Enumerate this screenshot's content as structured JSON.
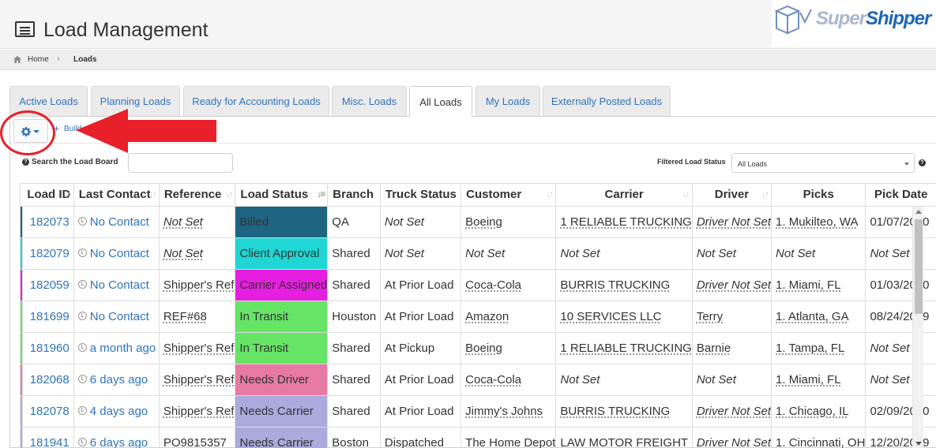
{
  "header": {
    "title": "Load Management",
    "icon": "list-box-icon"
  },
  "logo": {
    "super": "Super",
    "shipper": "Shipper"
  },
  "breadcrumb": {
    "home": "Home",
    "current": "Loads"
  },
  "tabs": [
    {
      "label": "Active Loads",
      "active": false
    },
    {
      "label": "Planning Loads",
      "active": false
    },
    {
      "label": "Ready for Accounting Loads",
      "active": false
    },
    {
      "label": "Misc. Loads",
      "active": false
    },
    {
      "label": "All Loads",
      "active": true
    },
    {
      "label": "My Loads",
      "active": false
    },
    {
      "label": "Externally Posted Loads",
      "active": false
    }
  ],
  "toolbar": {
    "build_plus": "+",
    "build_label": "Build"
  },
  "search": {
    "label": "Search the Load Board",
    "value": ""
  },
  "status_filter": {
    "label": "Filtered Load Status",
    "selected": "All Loads"
  },
  "columns": [
    "Load ID",
    "Last Contact",
    "Reference",
    "Load Status",
    "Branch",
    "Truck Status",
    "Customer",
    "Carrier",
    "Driver",
    "Picks",
    "Pick Date"
  ],
  "rows": [
    {
      "stripe": "#1f6581",
      "load_id": "182073",
      "last_contact": "No Contact",
      "reference": "Not Set",
      "load_status": "Billed",
      "status_color": "#1f6581",
      "branch": "QA",
      "truck_status": "Not Set",
      "customer": "Boeing",
      "carrier": "1 RELIABLE TRUCKING",
      "driver": "Driver Not Set",
      "picks": "1. Mukilteo, WA",
      "pick_date": "01/07/2020"
    },
    {
      "stripe": "#1fd6d4",
      "load_id": "182079",
      "last_contact": "No Contact",
      "reference": "Not Set",
      "load_status": "Client Approval",
      "status_color": "#1fd6d4",
      "branch": "Shared",
      "truck_status": "Not Set",
      "customer": "Not Set",
      "carrier": "Not Set",
      "driver": "Not Set",
      "picks": "Not Set",
      "pick_date": "Not Set"
    },
    {
      "stripe": "#e61ee0",
      "load_id": "182059",
      "last_contact": "No Contact",
      "reference": "Shipper's Ref",
      "load_status": "Carrier Assigned",
      "status_color": "#e61ee0",
      "branch": "Shared",
      "truck_status": "At Prior Load",
      "customer": "Coca-Cola",
      "carrier": "BURRIS TRUCKING",
      "driver": "Driver Not Set",
      "picks": "1. Miami, FL",
      "pick_date": "01/03/2020"
    },
    {
      "stripe": "#66e466",
      "load_id": "181699",
      "last_contact": "No Contact",
      "reference": "REF#68",
      "load_status": "In Transit",
      "status_color": "#66e466",
      "branch": "Houston",
      "truck_status": "At Prior Load",
      "customer": "Amazon",
      "carrier": "10 SERVICES LLC",
      "driver": "Terry",
      "picks": "1. Atlanta, GA",
      "pick_date": "08/24/2019"
    },
    {
      "stripe": "#66e466",
      "load_id": "181960",
      "last_contact": "a month ago",
      "reference": "Shipper's Ref",
      "load_status": "In Transit",
      "status_color": "#66e466",
      "branch": "Shared",
      "truck_status": "At Pickup",
      "customer": "Boeing",
      "carrier": "1 RELIABLE TRUCKING",
      "driver": "Barnie",
      "picks": "1. Tampa, FL",
      "pick_date": "Not Set"
    },
    {
      "stripe": "#e77aa2",
      "load_id": "182068",
      "last_contact": "6 days ago",
      "reference": "Shipper's Ref",
      "load_status": "Needs Driver",
      "status_color": "#e77aa2",
      "branch": "Shared",
      "truck_status": "At Prior Load",
      "customer": "Coca-Cola",
      "carrier": "Not Set",
      "driver": "Not Set",
      "picks": "1. Miami, FL",
      "pick_date": "Not Set"
    },
    {
      "stripe": "#aaaadc",
      "load_id": "182078",
      "last_contact": "4 days ago",
      "reference": "Shipper's Ref",
      "load_status": "Needs Carrier",
      "status_color": "#aaaadc",
      "branch": "Shared",
      "truck_status": "At Prior Load",
      "customer": "Jimmy's Johns",
      "carrier": "BURRIS TRUCKING",
      "driver": "Driver Not Set",
      "picks": "1. Chicago, IL",
      "pick_date": "02/09/2020"
    },
    {
      "stripe": "#aaaadc",
      "load_id": "181941",
      "last_contact": "6 days ago",
      "reference": "PO9815357",
      "load_status": "Needs Carrier",
      "status_color": "#aaaadc",
      "branch": "Boston",
      "truck_status": "Dispatched",
      "customer": "The Home Depot",
      "carrier": "LAW MOTOR FREIGHT",
      "driver": "Driver Not Set",
      "picks": "1. Cincinnati, OH",
      "pick_date": "12/20/2019"
    }
  ]
}
